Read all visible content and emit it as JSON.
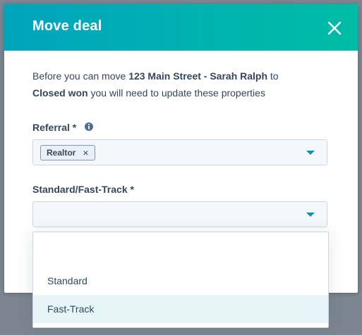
{
  "modal": {
    "title": "Move deal",
    "intro": {
      "before": "Before you can move ",
      "deal_name": "123 Main Street - Sarah Ralph",
      "to": " to ",
      "stage": "Closed won",
      "after": " you will need to update these properties"
    }
  },
  "fields": {
    "referral": {
      "label": "Referral *",
      "tags": [
        "Realtor"
      ]
    },
    "standard_fast_track": {
      "label": "Standard/Fast-Track *",
      "value": ""
    }
  },
  "dropdown": {
    "options": [
      "",
      "Standard",
      "Fast-Track"
    ],
    "highlighted": "Fast-Track"
  },
  "colors": {
    "header_start": "#00a4bd",
    "header_end": "#00bda5",
    "text": "#33475b",
    "caret": "#0091ae",
    "highlight": "#e5f5f8"
  },
  "icons": {
    "close": "close-icon",
    "info": "info-icon",
    "caret": "caret-down-icon",
    "tag_remove": "remove-tag-icon"
  }
}
